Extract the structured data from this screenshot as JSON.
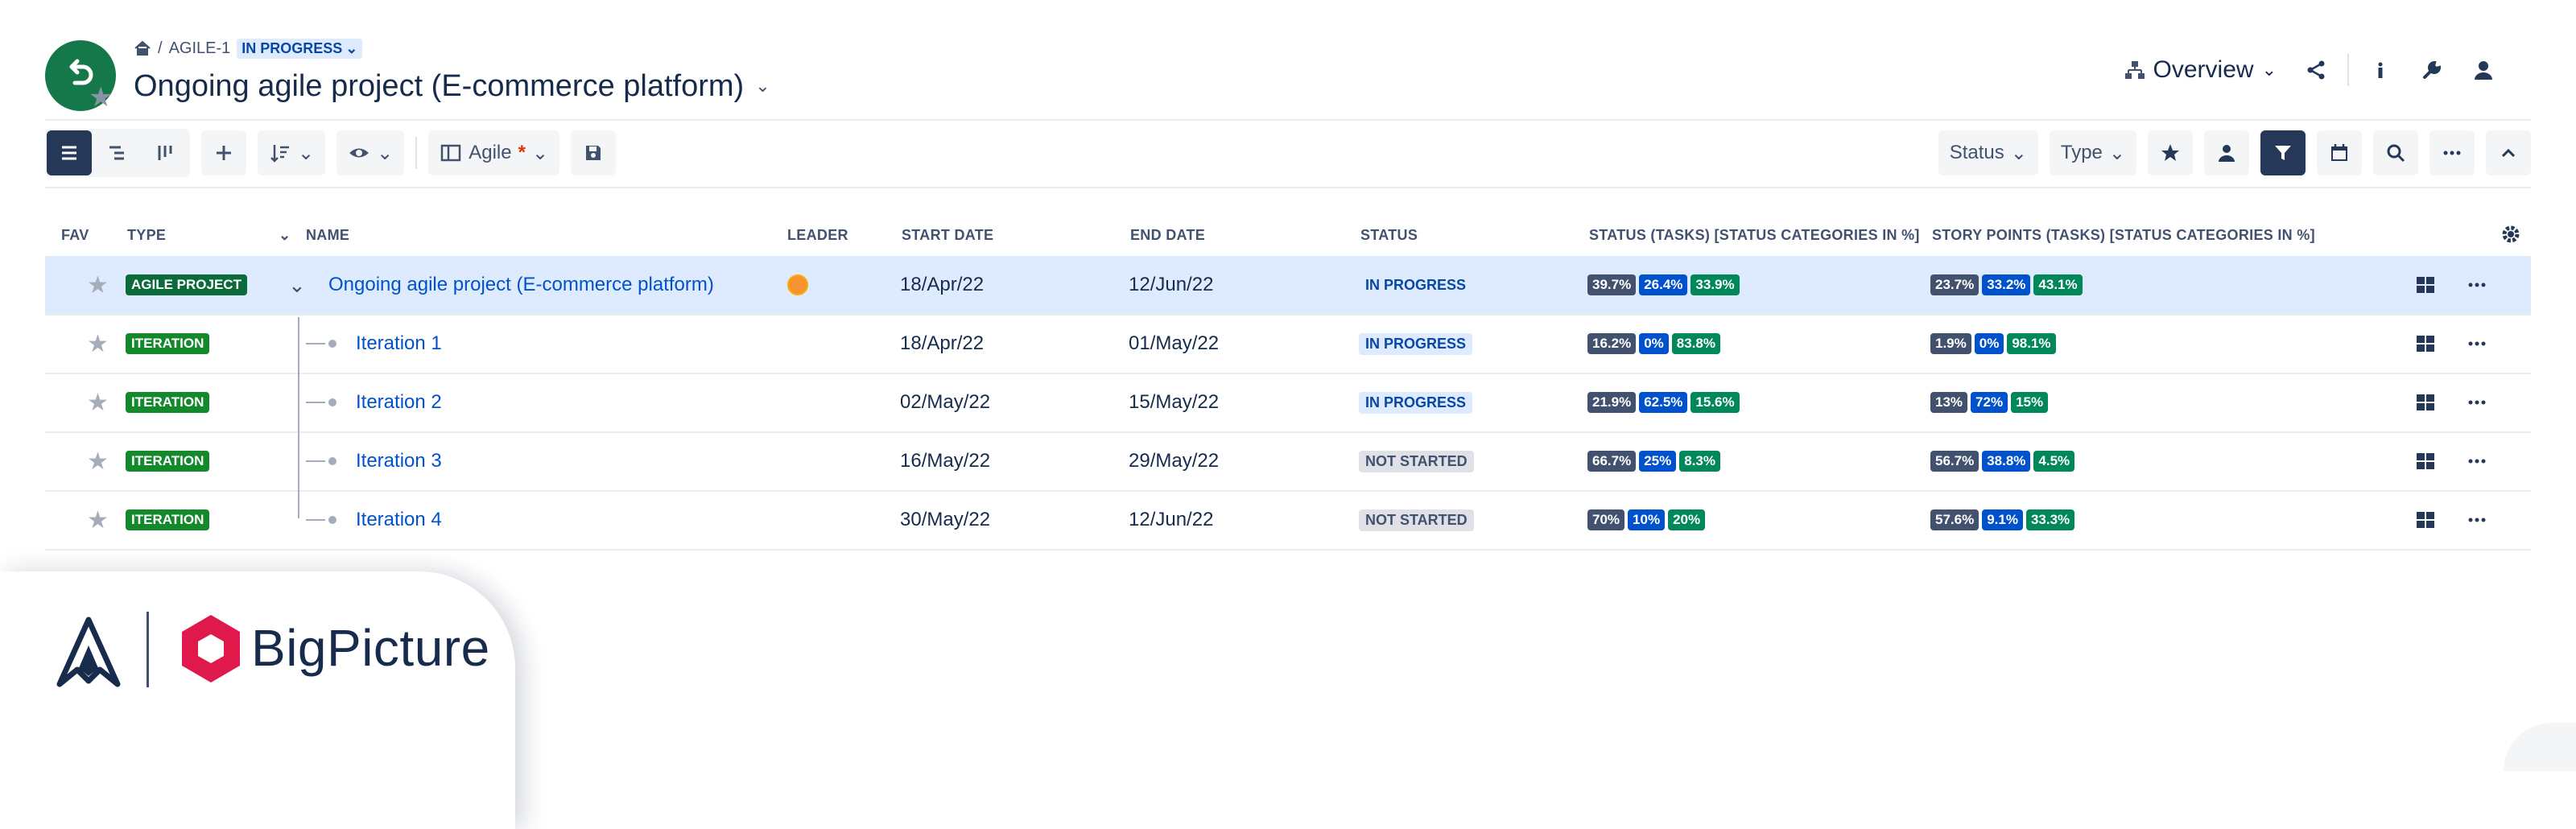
{
  "breadcrumb": {
    "key": "AGILE-1",
    "status": "IN PROGRESS"
  },
  "header": {
    "title": "Ongoing agile project (E-commerce platform)",
    "overview_label": "Overview"
  },
  "toolbar": {
    "agile_label": "Agile",
    "agile_modified": "*",
    "status_filter": "Status",
    "type_filter": "Type"
  },
  "columns": {
    "fav": "FAV",
    "type": "TYPE",
    "name": "NAME",
    "leader": "LEADER",
    "start": "START DATE",
    "end": "END DATE",
    "status": "STATUS",
    "status_tasks": "STATUS (TASKS) [STATUS CATEGORIES IN %]",
    "story_points": "STORY POINTS (TASKS) [STATUS CATEGORIES IN %]"
  },
  "rows": [
    {
      "type": "AGILE PROJECT",
      "name": "Ongoing agile project (E-commerce platform)",
      "start": "18/Apr/22",
      "end": "12/Jun/22",
      "status": "IN PROGRESS",
      "status_pct": [
        "39.7%",
        "26.4%",
        "33.9%"
      ],
      "sp_pct": [
        "23.7%",
        "33.2%",
        "43.1%"
      ]
    },
    {
      "type": "ITERATION",
      "name": "Iteration 1",
      "start": "18/Apr/22",
      "end": "01/May/22",
      "status": "IN PROGRESS",
      "status_pct": [
        "16.2%",
        "0%",
        "83.8%"
      ],
      "sp_pct": [
        "1.9%",
        "0%",
        "98.1%"
      ]
    },
    {
      "type": "ITERATION",
      "name": "Iteration 2",
      "start": "02/May/22",
      "end": "15/May/22",
      "status": "IN PROGRESS",
      "status_pct": [
        "21.9%",
        "62.5%",
        "15.6%"
      ],
      "sp_pct": [
        "13%",
        "72%",
        "15%"
      ]
    },
    {
      "type": "ITERATION",
      "name": "Iteration 3",
      "start": "16/May/22",
      "end": "29/May/22",
      "status": "NOT STARTED",
      "status_pct": [
        "66.7%",
        "25%",
        "8.3%"
      ],
      "sp_pct": [
        "56.7%",
        "38.8%",
        "4.5%"
      ]
    },
    {
      "type": "ITERATION",
      "name": "Iteration 4",
      "start": "30/May/22",
      "end": "12/Jun/22",
      "status": "NOT STARTED",
      "status_pct": [
        "70%",
        "10%",
        "20%"
      ],
      "sp_pct": [
        "57.6%",
        "9.1%",
        "33.3%"
      ]
    }
  ],
  "brand": {
    "name": "BigPicture"
  },
  "colors": {
    "project_icon": "#14784a",
    "selected_row": "#deebff",
    "link": "#0052cc",
    "todo": "#42526e",
    "in_progress": "#0052cc",
    "done": "#00875a",
    "brand_hex": "#e0194d"
  }
}
